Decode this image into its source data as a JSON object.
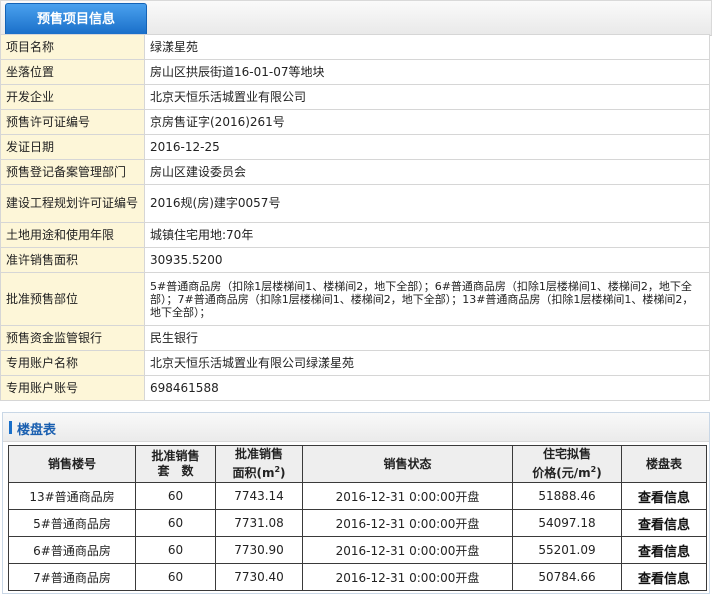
{
  "tab": {
    "title": "预售项目信息"
  },
  "info_rows": [
    {
      "label": "项目名称",
      "value": "绿漾星苑"
    },
    {
      "label": "坐落位置",
      "value": "房山区拱辰街道16-01-07等地块"
    },
    {
      "label": "开发企业",
      "value": "北京天恒乐活城置业有限公司"
    },
    {
      "label": "预售许可证编号",
      "value": "京房售证字(2016)261号"
    },
    {
      "label": "发证日期",
      "value": "2016-12-25"
    },
    {
      "label": "预售登记备案管理部门",
      "value": "房山区建设委员会"
    },
    {
      "label": "建设工程规划许可证编号",
      "value": "2016规(房)建字0057号"
    },
    {
      "label": "土地用途和使用年限",
      "value": "城镇住宅用地:70年"
    },
    {
      "label": "准许销售面积",
      "value": "30935.5200"
    },
    {
      "label": "批准预售部位",
      "value": "5#普通商品房（扣除1层楼梯间1、楼梯间2，地下全部）；6#普通商品房（扣除1层楼梯间1、楼梯间2，地下全部）；7#普通商品房（扣除1层楼梯间1、楼梯间2，地下全部）；13#普通商品房（扣除1层楼梯间1、楼梯间2，地下全部）；"
    },
    {
      "label": "预售资金监管银行",
      "value": "民生银行"
    },
    {
      "label": "专用账户名称",
      "value": "北京天恒乐活城置业有限公司绿漾星苑"
    },
    {
      "label": "专用账户账号",
      "value": "698461588"
    }
  ],
  "section": {
    "title": "楼盘表"
  },
  "list": {
    "headers": {
      "building": "销售楼号",
      "units_l1": "批准销售",
      "units_l2": "套　数",
      "area_l1": "批准销售",
      "area_l2": "面积(m",
      "area_sup": "2",
      "area_end": ")",
      "status": "销售状态",
      "price_l1": "住宅拟售",
      "price_l2": "价格(元/m",
      "price_sup": "2",
      "price_end": ")",
      "table": "楼盘表"
    },
    "rows": [
      {
        "building": "13#普通商品房",
        "units": "60",
        "area": "7743.14",
        "status": "2016-12-31 0:00:00开盘",
        "price": "51888.46",
        "link": "查看信息"
      },
      {
        "building": "5#普通商品房",
        "units": "60",
        "area": "7731.08",
        "status": "2016-12-31 0:00:00开盘",
        "price": "54097.18",
        "link": "查看信息"
      },
      {
        "building": "6#普通商品房",
        "units": "60",
        "area": "7730.90",
        "status": "2016-12-31 0:00:00开盘",
        "price": "55201.09",
        "link": "查看信息"
      },
      {
        "building": "7#普通商品房",
        "units": "60",
        "area": "7730.40",
        "status": "2016-12-31 0:00:00开盘",
        "price": "50784.66",
        "link": "查看信息"
      }
    ]
  }
}
